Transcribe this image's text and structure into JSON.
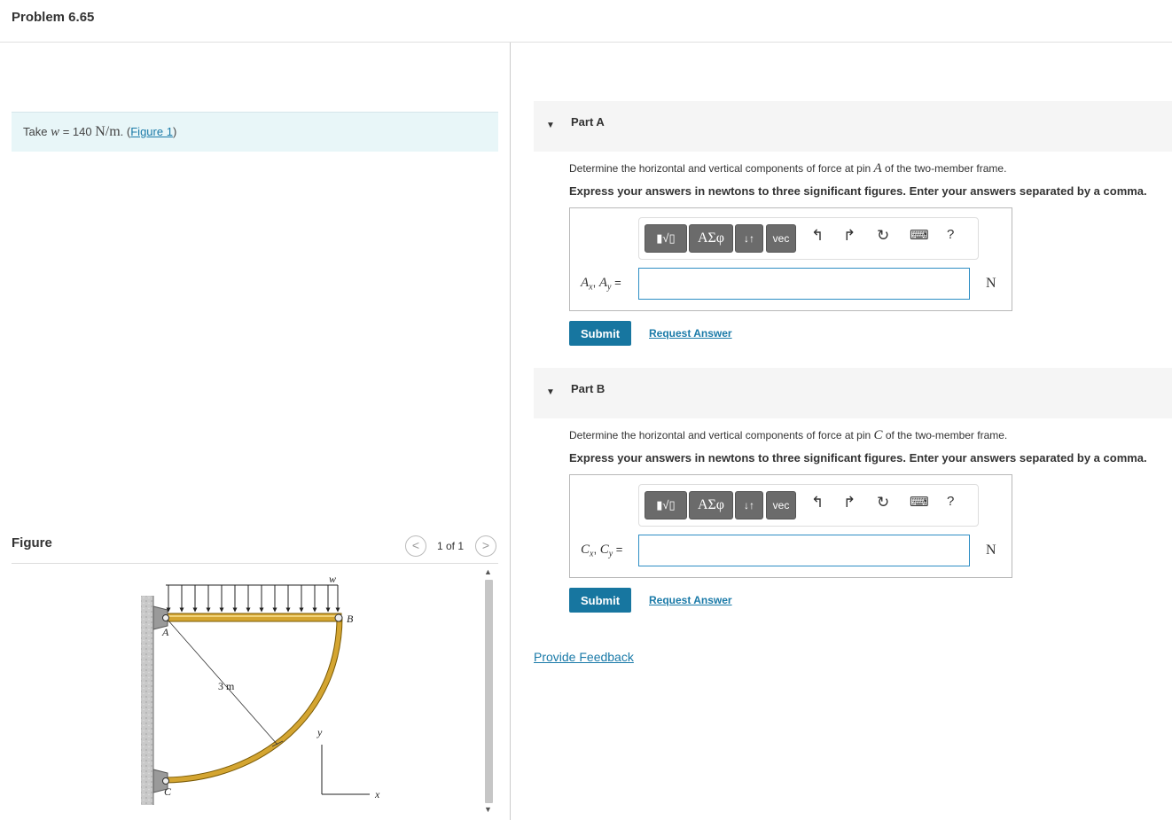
{
  "problem": {
    "title": "Problem 6.65"
  },
  "given": {
    "prefix": "Take ",
    "var": "w",
    "eq": " = 140 ",
    "unit": "N/m",
    "dot": ". (",
    "figure_link": "Figure 1",
    "close": ")"
  },
  "figure": {
    "label": "Figure",
    "pager": "1 of 1",
    "prev": "<",
    "next": ">",
    "labels": {
      "w": "w",
      "A": "A",
      "B": "B",
      "C": "C",
      "dim": "3 m",
      "y": "y",
      "x": "x"
    }
  },
  "toolbar": {
    "template_btn": "▮√▯",
    "greek_btn": "ΑΣφ",
    "arrows_btn": "↓↑",
    "vec_btn": "vec",
    "undo": "↰",
    "redo": "↱",
    "reset": "↻",
    "keyboard": "⌨",
    "help": "?"
  },
  "parts": [
    {
      "title": "Part A",
      "q_pre": "Determine the horizontal and vertical components of force at pin ",
      "q_var": "A",
      "q_post": " of the two-member frame.",
      "instruction": "Express your answers in newtons to three significant figures. Enter your answers separated by a comma.",
      "label": "Aₓ, Aᵧ =",
      "label_a": "A",
      "label_x": "x",
      "label_b": "A",
      "label_y": "y",
      "value": "",
      "unit": "N",
      "submit": "Submit",
      "request": "Request Answer"
    },
    {
      "title": "Part B",
      "q_pre": "Determine the horizontal and vertical components of force at pin ",
      "q_var": "C",
      "q_post": " of the two-member frame.",
      "instruction": "Express your answers in newtons to three significant figures. Enter your answers separated by a comma.",
      "label_a": "C",
      "label_x": "x",
      "label_b": "C",
      "label_y": "y",
      "value": "",
      "unit": "N",
      "submit": "Submit",
      "request": "Request Answer"
    }
  ],
  "feedback": "Provide Feedback"
}
